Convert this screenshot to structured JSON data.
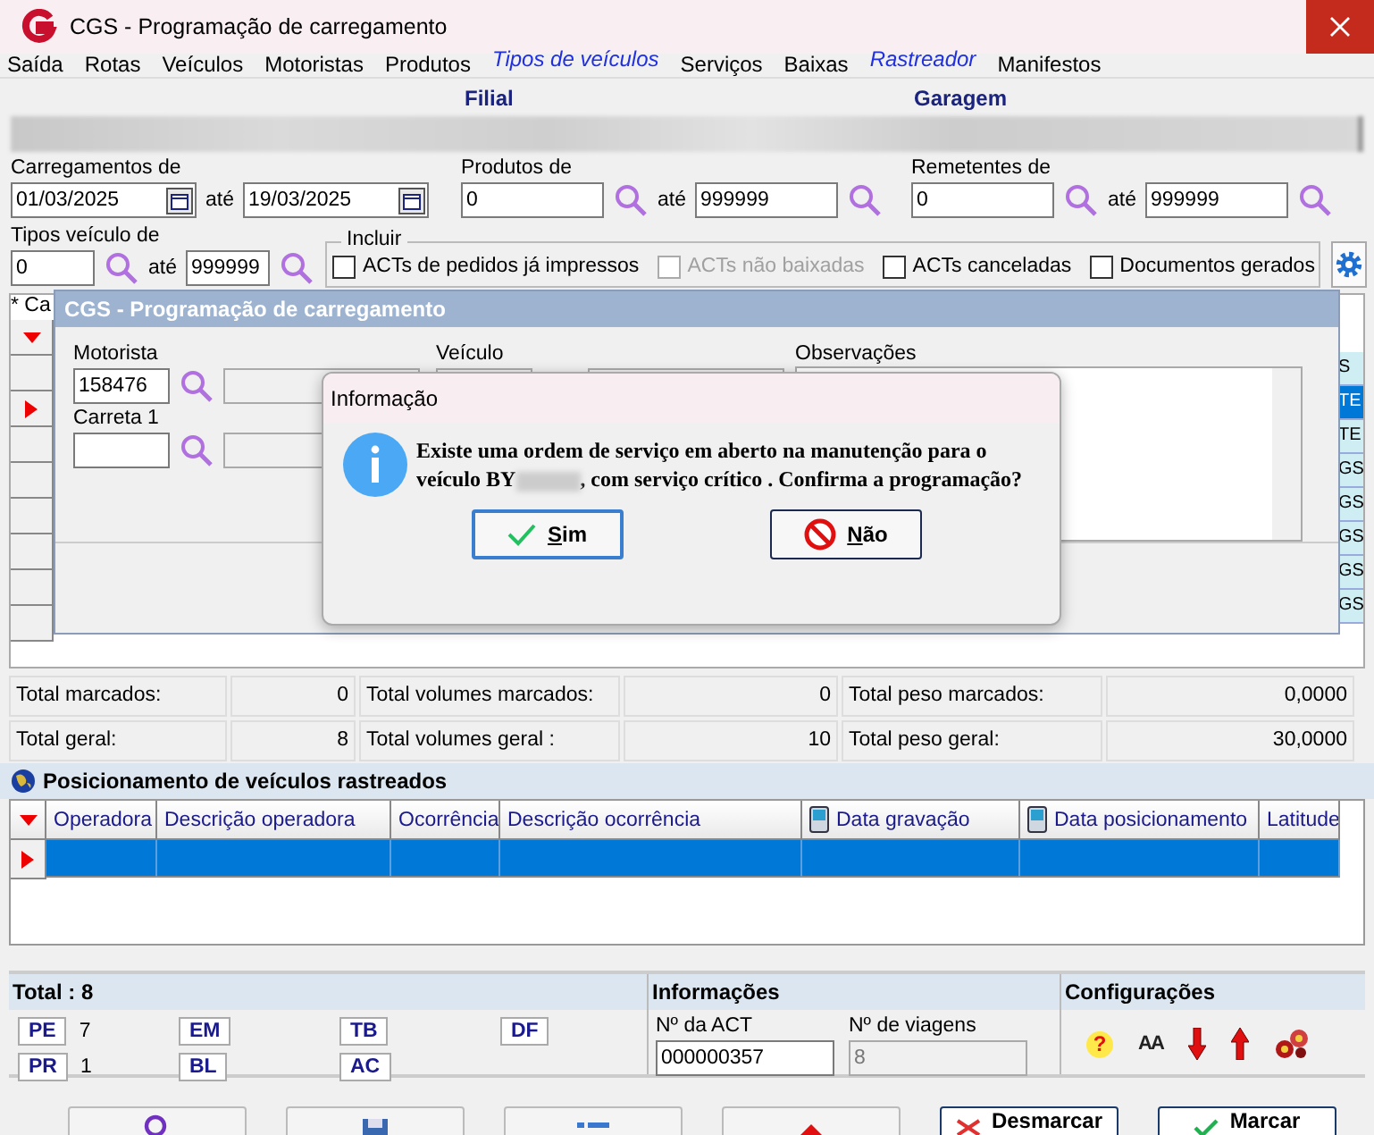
{
  "window": {
    "title": "CGS - Programação de carregamento"
  },
  "menu": [
    {
      "label": "Saída",
      "kind": "menu"
    },
    {
      "label": "Rotas",
      "kind": "menu"
    },
    {
      "label": "Veículos",
      "kind": "menu"
    },
    {
      "label": "Motoristas",
      "kind": "menu"
    },
    {
      "label": "Produtos",
      "kind": "menu"
    },
    {
      "label": "Tipos de veículos",
      "kind": "link"
    },
    {
      "label": "Serviços",
      "kind": "menu"
    },
    {
      "label": "Baixas",
      "kind": "menu"
    },
    {
      "label": "Rastreador",
      "kind": "link"
    },
    {
      "label": "Manifestos",
      "kind": "menu"
    }
  ],
  "filter": {
    "filial_label": "Filial",
    "garagem_label": "Garagem",
    "ranges": [
      {
        "label": "Carregamentos de",
        "from": "01/03/2025",
        "to_label": "até",
        "to": "19/03/2025",
        "kind": "date"
      },
      {
        "label": "Produtos de",
        "from": "0",
        "to_label": "até",
        "to": "999999",
        "kind": "lookup"
      },
      {
        "label": "Remetentes de",
        "from": "0",
        "to_label": "até",
        "to": "999999",
        "kind": "lookup"
      }
    ],
    "tipos": {
      "label": "Tipos veículo de",
      "from": "0",
      "to_label": "até",
      "to": "999999"
    },
    "incluir": {
      "label": "Incluir",
      "options": [
        {
          "label": "ACTs de pedidos já impressos",
          "checked": false,
          "disabled": false
        },
        {
          "label": "ACTs não baixadas",
          "checked": false,
          "disabled": true
        },
        {
          "label": "ACTs canceladas",
          "checked": false,
          "disabled": false
        },
        {
          "label": "Documentos gerados",
          "checked": false,
          "disabled": false
        }
      ]
    }
  },
  "grid": {
    "note": "* Ca",
    "rows": [
      {
        "text": "S",
        "selected": false
      },
      {
        "text": "TE",
        "selected": true
      },
      {
        "text": "TE",
        "selected": false
      },
      {
        "text": "GS",
        "selected": false
      },
      {
        "text": "GS",
        "selected": false
      },
      {
        "text": "GS",
        "selected": false
      },
      {
        "text": "GS",
        "selected": false
      },
      {
        "text": "GS",
        "selected": false
      }
    ]
  },
  "dialog": {
    "title": "CGS - Programação de carregamento",
    "motorista_label": "Motorista",
    "motorista": "158476",
    "carreta_label": "Carreta 1",
    "veiculo_label": "Veículo",
    "observacoes_label": "Observações"
  },
  "message_box": {
    "title": "Informação",
    "message_before": "Existe uma ordem de serviço em aberto na manutenção para o veículo BY",
    "message_after": ", com serviço crítico . Confirma a programação?",
    "buttons": [
      {
        "label": "Sim",
        "kind": "yes",
        "selected": true
      },
      {
        "label": "Não",
        "kind": "no",
        "selected": false
      }
    ]
  },
  "totals": [
    {
      "label": "Total marcados:",
      "value": "0"
    },
    {
      "label": "Total volumes marcados:",
      "value": "0"
    },
    {
      "label": "Total peso marcados:",
      "value": "0,0000"
    },
    {
      "label": "Total geral:",
      "value": "8"
    },
    {
      "label": "Total volumes geral :",
      "value": "10"
    },
    {
      "label": "Total peso geral:",
      "value": "30,0000"
    }
  ],
  "tracking": {
    "title": "Posicionamento de veículos rastreados",
    "columns": [
      {
        "label": "Operadora",
        "icon": false
      },
      {
        "label": "Descrição operadora",
        "icon": false
      },
      {
        "label": "Ocorrência",
        "icon": false
      },
      {
        "label": "Descrição ocorrência",
        "icon": false
      },
      {
        "label": "Data gravação",
        "icon": true
      },
      {
        "label": "Data posicionamento",
        "icon": true
      },
      {
        "label": "Latitude",
        "icon": false
      }
    ],
    "rows": [
      {
        "selected": true
      }
    ]
  },
  "summary": {
    "title": "Total : 8",
    "codes": [
      {
        "code": "PE",
        "count": "7"
      },
      {
        "code": "EM"
      },
      {
        "code": "TB"
      },
      {
        "code": "DF"
      },
      {
        "code": "PR",
        "count": "1"
      },
      {
        "code": "BL"
      },
      {
        "code": "AC"
      }
    ]
  },
  "info": {
    "title": "Informações",
    "act_label": "Nº da ACT",
    "act": "000000357",
    "viagens_label": "Nº de viagens",
    "viagens": "8"
  },
  "config": {
    "title": "Configurações",
    "help": "?",
    "font": "AA"
  },
  "footer_buttons": [
    {
      "kind": "search"
    },
    {
      "kind": "save"
    },
    {
      "kind": "list"
    },
    {
      "kind": "clear"
    },
    {
      "kind": "uncheck",
      "label": "Desmarcar"
    },
    {
      "kind": "check",
      "label": "Marcar"
    }
  ]
}
